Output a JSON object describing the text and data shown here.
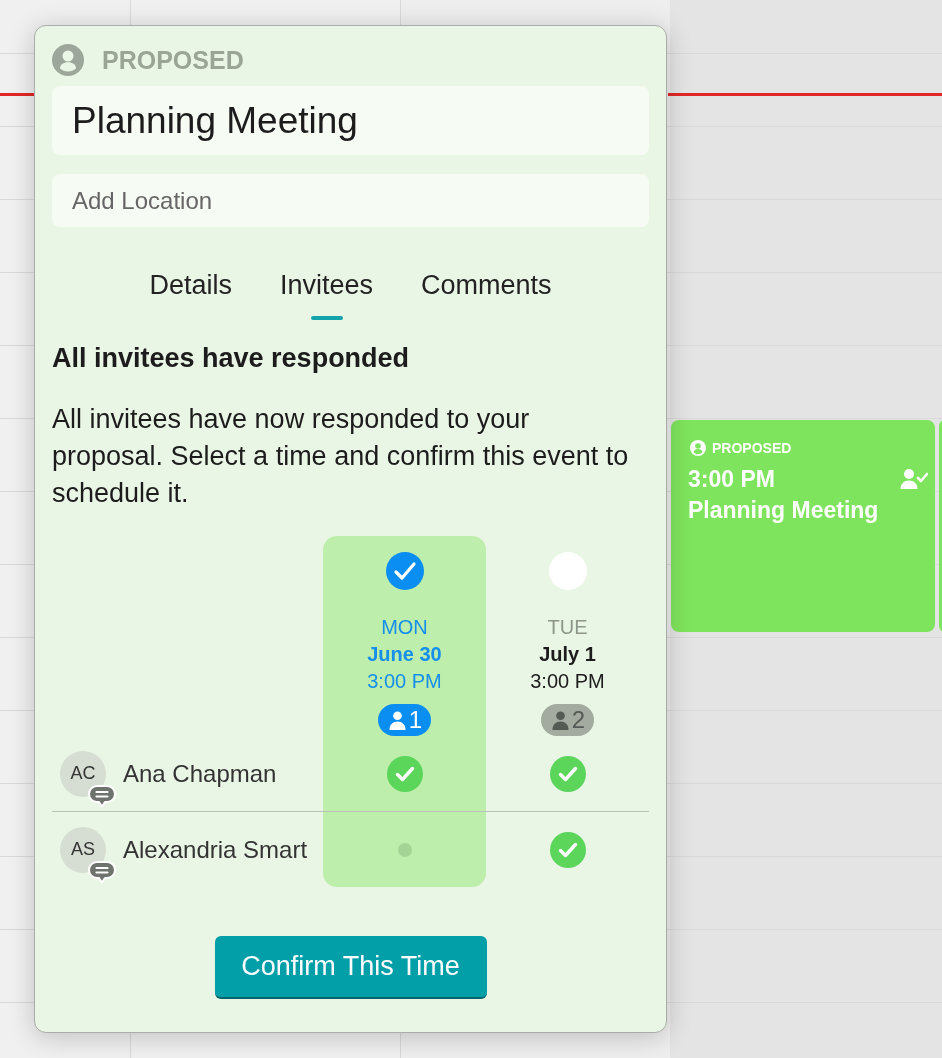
{
  "calendar": {
    "events": [
      {
        "status": "PROPOSED",
        "time": "3:00 PM",
        "title": "Planning Meeting"
      }
    ]
  },
  "popup": {
    "status": "PROPOSED",
    "title": "Planning Meeting",
    "location": {
      "placeholder": "Add Location"
    },
    "tabs": [
      {
        "label": "Details",
        "selected": false
      },
      {
        "label": "Invitees",
        "selected": true
      },
      {
        "label": "Comments",
        "selected": false
      }
    ],
    "heading": "All invitees have responded",
    "message": "All invitees have now responded to your proposal. Select a time and confirm this event to schedule it.",
    "options": [
      {
        "day": "MON",
        "date": "June 30",
        "time": "3:00 PM",
        "votes": "1",
        "selected": true
      },
      {
        "day": "TUE",
        "date": "July 1",
        "time": "3:00 PM",
        "votes": "2",
        "selected": false
      }
    ],
    "invitees": [
      {
        "initials": "AC",
        "name": "Ana Chapman",
        "has_comment": true,
        "responses": [
          {
            "accepted": true
          },
          {
            "accepted": true
          }
        ]
      },
      {
        "initials": "AS",
        "name": "Alexandria Smart",
        "has_comment": true,
        "responses": [
          {
            "accepted": false
          },
          {
            "accepted": true
          }
        ]
      }
    ],
    "confirm_button": "Confirm This Time"
  }
}
